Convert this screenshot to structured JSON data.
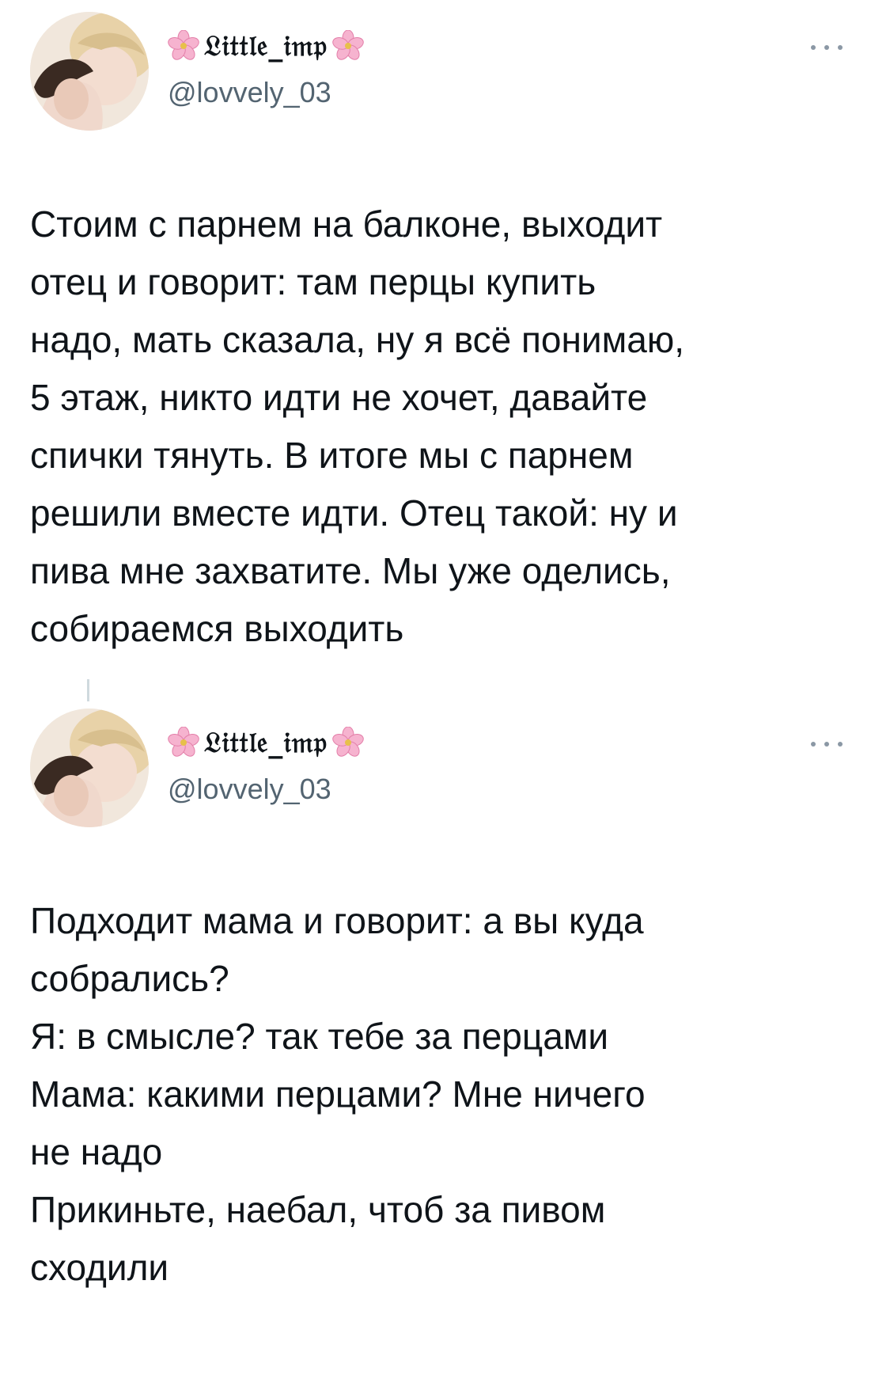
{
  "tweets": [
    {
      "display_name": "𝔏𝔦𝔱𝔱𝔩𝔢_𝔦𝔪𝔭",
      "handle": "@lovvely_03",
      "avatar_icon": "profile-photo",
      "flower_icon": "cherry-blossom",
      "more_icon": "more-dots",
      "text": "Стоим с парнем на балконе, выходит\nотец и говорит: там перцы купить\nнадо, мать сказала, ну я всё понимаю,\n5 этаж, никто идти не хочет, давайте\nспички тянуть. В итоге мы с парнем\nрешили вместе идти. Отец такой: ну и\nпива мне захватите. Мы уже оделись,\nсобираемся выходить"
    },
    {
      "display_name": "𝔏𝔦𝔱𝔱𝔩𝔢_𝔦𝔪𝔭",
      "handle": "@lovvely_03",
      "avatar_icon": "profile-photo",
      "flower_icon": "cherry-blossom",
      "more_icon": "more-dots",
      "text": "Подходит мама и говорит: а вы куда\nсобрались?\nЯ: в смысле? так тебе за перцами\nМама: какими перцами? Мне ничего\nне надо\nПрикиньте, наебал, чтоб за пивом\nсходили"
    }
  ],
  "colors": {
    "text": "#0f1419",
    "secondary": "#536471",
    "thread_line": "#cfd9de",
    "flower": "#f4a6c8"
  }
}
